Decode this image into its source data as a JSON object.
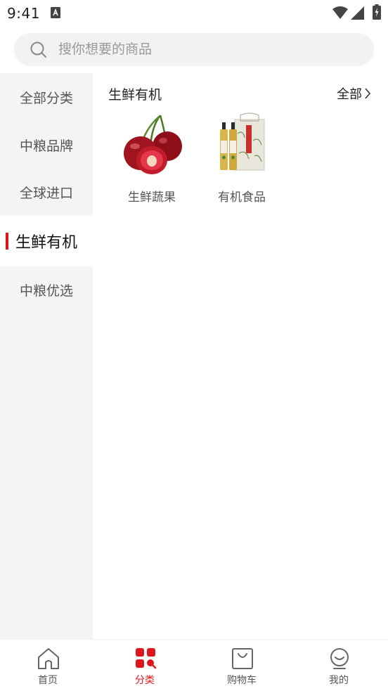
{
  "status_bar": {
    "time": "9:41"
  },
  "search": {
    "placeholder": "搜你想要的商品"
  },
  "sidebar": {
    "items": [
      {
        "label": "全部分类",
        "active": false
      },
      {
        "label": "中粮品牌",
        "active": false
      },
      {
        "label": "全球进口",
        "active": false
      },
      {
        "label": "生鲜有机",
        "active": true
      },
      {
        "label": "中粮优选",
        "active": false
      }
    ]
  },
  "content": {
    "title": "生鲜有机",
    "all_link": "全部",
    "subcategories": [
      {
        "label": "生鲜蔬果",
        "icon": "cherries-image"
      },
      {
        "label": "有机食品",
        "icon": "oil-bottles-gift-box-image"
      }
    ]
  },
  "bottom_nav": {
    "items": [
      {
        "label": "首页",
        "icon": "home-icon",
        "active": false
      },
      {
        "label": "分类",
        "icon": "category-icon",
        "active": true
      },
      {
        "label": "购物车",
        "icon": "shopping-bag-icon",
        "active": false
      },
      {
        "label": "我的",
        "icon": "profile-icon",
        "active": false
      }
    ]
  },
  "colors": {
    "accent": "#e0141e",
    "sidebar_bg": "#f4f4f4",
    "search_bg": "#f2f2f2"
  }
}
